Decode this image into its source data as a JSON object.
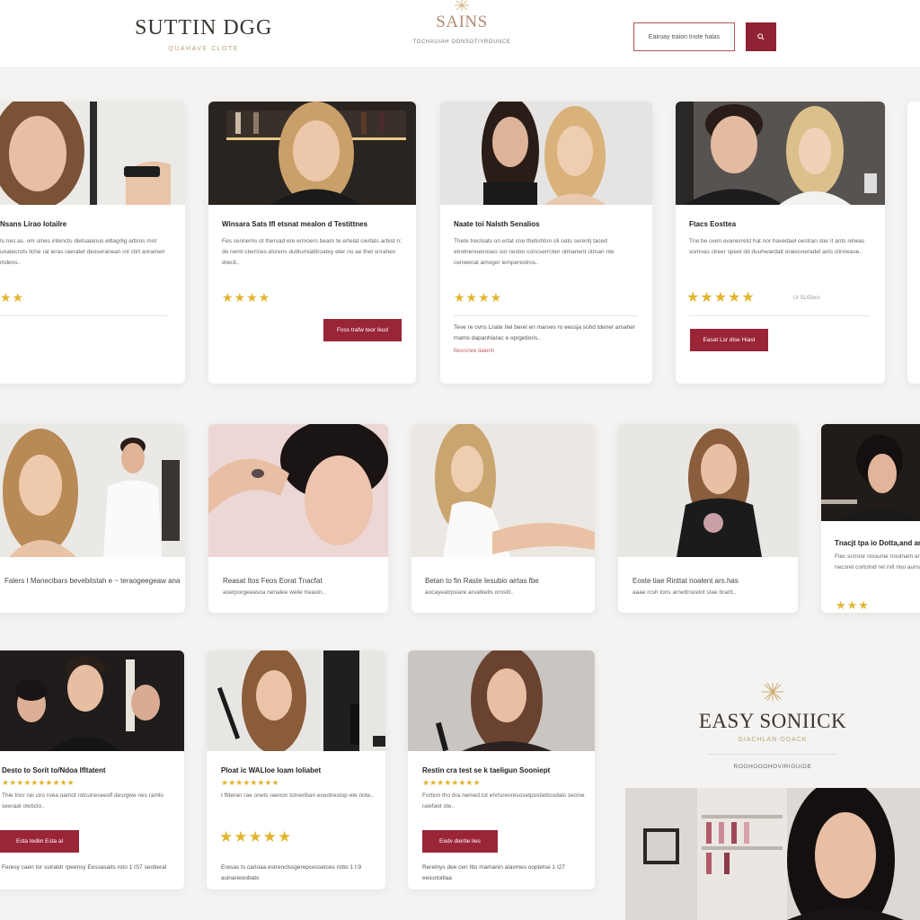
{
  "header": {
    "logo_left": "SUTTIN DGG",
    "logo_left_tagline": "QUAHAVE CLOTE",
    "logo_center": "SAINS",
    "logo_center_tagline": "TOCHAUIAH OONSOTIYROUNCE",
    "search_placeholder": "Eairoay traion Inote halas",
    "search_icon": "search-icon",
    "accent_color": "#8f2234"
  },
  "row1": [
    {
      "title": "Nsans Lirao Iotailre",
      "desc": "Is nes as. om ulnes intenctu dietsaianus eitlagrlig arbros mot unatecrots liche ral ieras raeratet deoseranean rot ctirt anramen mdens..",
      "stars": "★★",
      "button": "",
      "meta": "",
      "link": "",
      "foot": ""
    },
    {
      "title": "Winsara Sats Ifl etsnat mealon d Testittnes",
      "desc": "Fes cennerns ot thervad ere ermoers bearn te ertelat cierlats arbist n; de nemt cterrices elcrens dutlrumiattiroatey eter no ae thet snrahen drecit..",
      "stars": "★★★★",
      "button": "Foss trafw teor Ikud",
      "meta": "",
      "link": "",
      "foot": ""
    },
    {
      "title": "Naate toi Nalsth Senalios",
      "desc": "Thete trecloats on ertat cne thetishton oli oato serentj taced etrotnenoeiroseo sor nestor concserrcten otmanent otrnan nte cenwenat amoger iemperestros..",
      "stars": "★★★★",
      "button": "",
      "meta": "",
      "link": "Besrcnee daienh",
      "foot": "Teve re ovns Lnate Itel berel en marves ro eessja sohd tdener amaher rnams dapanhiarac e oprgetioris.."
    },
    {
      "title": "Ftacs Eosttea",
      "desc": "Tne be oven evanerretd hat nor havedael oestran ster it ants relwas somnas clreer speet dd duuhwardalt oraleoneradel anis clinnease..",
      "stars": "★★★★★",
      "button": "Easat Lsr dise Hiast",
      "meta": "Ul SLIDocs",
      "link": "",
      "foot": ""
    }
  ],
  "row2": [
    {
      "title": "Falers I Manecibars bevebitstah e ~ teraogeegeaw anaiss",
      "desc": "",
      "stars": ""
    },
    {
      "title": "Reasat Itos Feos Eorat Tnacfat",
      "desc": "aoerporgeeasoa nenalee weiie treastn..",
      "stars": ""
    },
    {
      "title": "Betan to fin Raste Iesubio airtas fbe",
      "desc": "aocayeatrpsiare arvatkelts ornstit..",
      "stars": ""
    },
    {
      "title": "Eoste tiae Rinttat noalent ars.has",
      "desc": "aaae rcsh tons arnettnsrelot stae brartt..",
      "stars": ""
    },
    {
      "title": "Tnacjt tpa io Dotta,and ans",
      "desc": "Fiec scrroor nnoume rroulnam an necsret cortotnd ret rvtl rioo aunstr..",
      "stars": "★★★"
    }
  ],
  "row3": [
    {
      "title": "Desto to Sorit to/Ndoa Ifltatent",
      "small_stars": "★★★★★★★★★★",
      "desc": "Thie trior cei ciro roea oamot rotcuneseesfl desrgwe nes ramlo seeraat oteticlo..",
      "button": "Esta tedlin Esta al",
      "big_stars": "",
      "foot": "Feresy caen tor sstratdr rpeensy Eessasaits roto 1 IS7 seotieral"
    },
    {
      "title": "Ploat ic WALloe Ioam Ioliabet",
      "small_stars": "★★★★★★★★",
      "desc": "I ftitener rae onets raenon totneriban eceotrestop ete note..",
      "button": "",
      "big_stars": "★★★★★",
      "foot": "Eresas ts carioaa estrenclssgerepcessetces rotto 1 I:9 asinaneoobats"
    },
    {
      "title": "Restin cra test se k taeligun Sooniept",
      "small_stars": "★★★★★★★★",
      "desc": "Fortion tho dra nemed tot ehrtsreoresosetpostiettoodals secine raiefaot ote..",
      "button": "Eedv diertie lies",
      "big_stars": "",
      "foot": "Rerelnys dee cen Itto mamanin alavmes ooptetse 1 I27 eeicotoitlaa"
    }
  ],
  "promo": {
    "brand": "EASY SONIICK",
    "tagline": "GIACHLAN  OOACK",
    "subtitle": "ROGHOOOHOVIRIGUIDE"
  }
}
